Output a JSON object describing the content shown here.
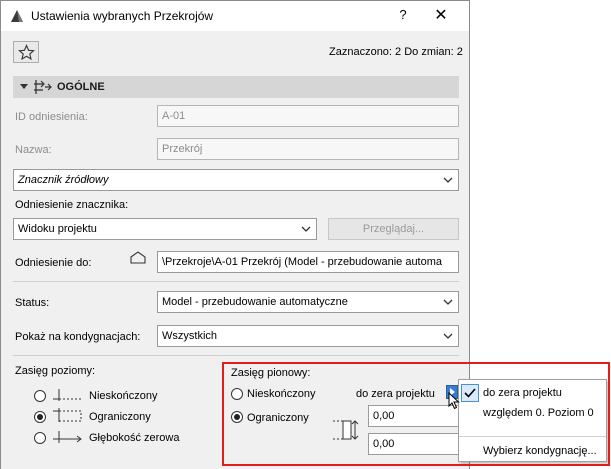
{
  "window": {
    "title": "Ustawienia wybranych Przekrojów",
    "help": "?",
    "close": "✕"
  },
  "toolbar": {
    "selection_info": "Zaznaczono: 2 Do zmian: 2"
  },
  "section": {
    "title": "OGÓLNE"
  },
  "fields": {
    "ref_id_label": "ID odniesienia:",
    "ref_id_value": "A-01",
    "name_label": "Nazwa:",
    "name_value": "Przekrój",
    "marker_combo": "Znacznik źródłowy",
    "marker_ref_label": "Odniesienie znacznika:",
    "marker_ref_combo": "Widoku projektu",
    "browse_button": "Przeglądaj...",
    "ref_to_label": "Odniesienie do:",
    "ref_to_value": "\\Przekroje\\A-01 Przekrój (Model - przebudowanie automa",
    "status_label": "Status:",
    "status_combo": "Model - przebudowanie automatyczne",
    "show_on_label": "Pokaż na kondygnacjach:",
    "show_on_combo": "Wszystkich"
  },
  "horizontal_range": {
    "title": "Zasięg poziomy:",
    "options": [
      "Nieskończony",
      "Ograniczony",
      "Głębokość zerowa"
    ],
    "selected": 1
  },
  "vertical_range": {
    "title": "Zasięg pionowy:",
    "options": [
      "Nieskończony",
      "Ograniczony"
    ],
    "selected": 1,
    "reference_label": "do zera projektu",
    "top_value": "0,00",
    "bottom_value": "0,00"
  },
  "popup_menu": {
    "items": [
      "do zera projektu",
      "względem 0. Poziom 0",
      "Wybierz kondygnację..."
    ],
    "checked": 0
  },
  "colors": {
    "highlight": "#e11d1d",
    "accent": "#3b7ad1"
  }
}
